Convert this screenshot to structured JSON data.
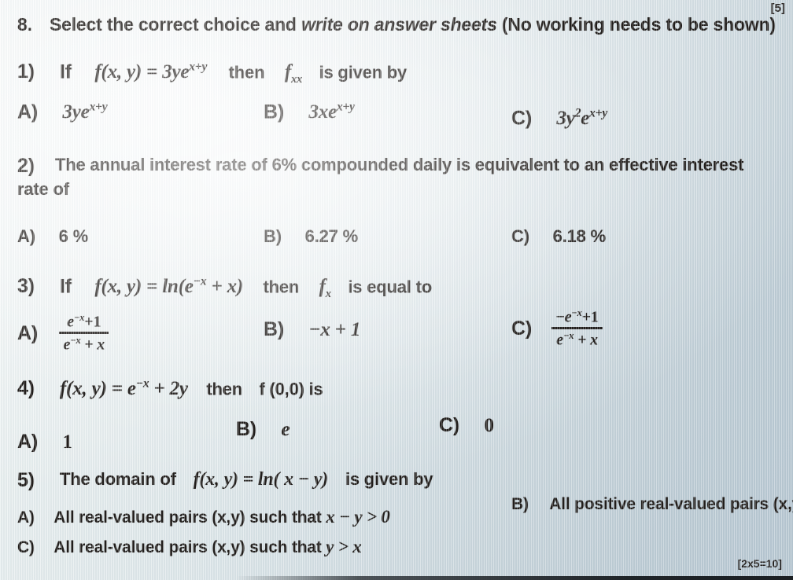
{
  "page": {
    "top_marks": "[5]",
    "bottom_marks": "[2x5=10]",
    "background_color": "#dde6e9",
    "text_color": "#17120f"
  },
  "question": {
    "number": "8.",
    "instruction_plain_1": "Select the correct choice and ",
    "instruction_italic": "write on answer sheets",
    "instruction_plain_2": " (No working needs to be shown)"
  },
  "items": [
    {
      "label": "1)",
      "stem_prefix": "If",
      "stem_function": "f(x, y) = 3ye",
      "stem_function_exp": "x+y",
      "stem_middle": "then",
      "stem_symbol": "f",
      "stem_symbol_sub": "xx",
      "stem_suffix": "is given by",
      "options": [
        {
          "letter": "A)",
          "text": "3ye",
          "exp": "x+y"
        },
        {
          "letter": "B)",
          "text": "3xe",
          "exp": "x+y"
        },
        {
          "letter": "C)",
          "text": "3y",
          "exp2": "2",
          "text2": "e",
          "exp": "x+y"
        }
      ]
    },
    {
      "label": "2)",
      "stem_line1": "The annual interest rate of  6%  compounded daily is equivalent to an effective interest",
      "stem_line2": "rate of",
      "options": [
        {
          "letter": "A)",
          "text": "6 %"
        },
        {
          "letter": "B)",
          "text": "6.27 %"
        },
        {
          "letter": "C)",
          "text": "6.18 %"
        }
      ]
    },
    {
      "label": "3)",
      "stem_prefix": "If",
      "stem_function": "f(x, y) = ln(e",
      "stem_function_exp": "−x",
      "stem_function_tail": " + x)",
      "stem_middle": "then",
      "stem_symbol": "f",
      "stem_symbol_sub": "x",
      "stem_suffix": "is equal to",
      "options": [
        {
          "letter": "A)",
          "numerator": "e−x+1",
          "denominator": "e−x + x",
          "num_base": "e",
          "num_exp": "−x",
          "num_tail": "+1",
          "den_base": "e",
          "den_exp": "−x",
          "den_tail": " + x"
        },
        {
          "letter": "B)",
          "text": "−x + 1"
        },
        {
          "letter": "C)",
          "num_lead": "−",
          "num_base": "e",
          "num_exp": "−x",
          "num_tail": "+1",
          "den_base": "e",
          "den_exp": "−x",
          "den_tail": " + x"
        }
      ]
    },
    {
      "label": "4)",
      "stem_function": "f(x, y) = e",
      "stem_function_exp": "−x",
      "stem_function_tail": " + 2y",
      "stem_middle": "then",
      "stem_suffix": "f (0,0) is",
      "options": [
        {
          "letter": "A)",
          "text": "1"
        },
        {
          "letter": "B)",
          "text": "e"
        },
        {
          "letter": "C)",
          "text": "0"
        }
      ]
    },
    {
      "label": "5)",
      "stem_prefix": "The domain of",
      "stem_function": "f(x, y) = ln( x − y)",
      "stem_suffix": "is given by",
      "options": [
        {
          "letter": "A)",
          "text": "All real-valued pairs (x,y) such that ",
          "math": "x − y > 0"
        },
        {
          "letter": "B)",
          "text": "All positive real-valued pairs (x,y)"
        },
        {
          "letter": "C)",
          "text": "All real-valued pairs (x,y) such that ",
          "math": "y > x"
        }
      ]
    }
  ]
}
